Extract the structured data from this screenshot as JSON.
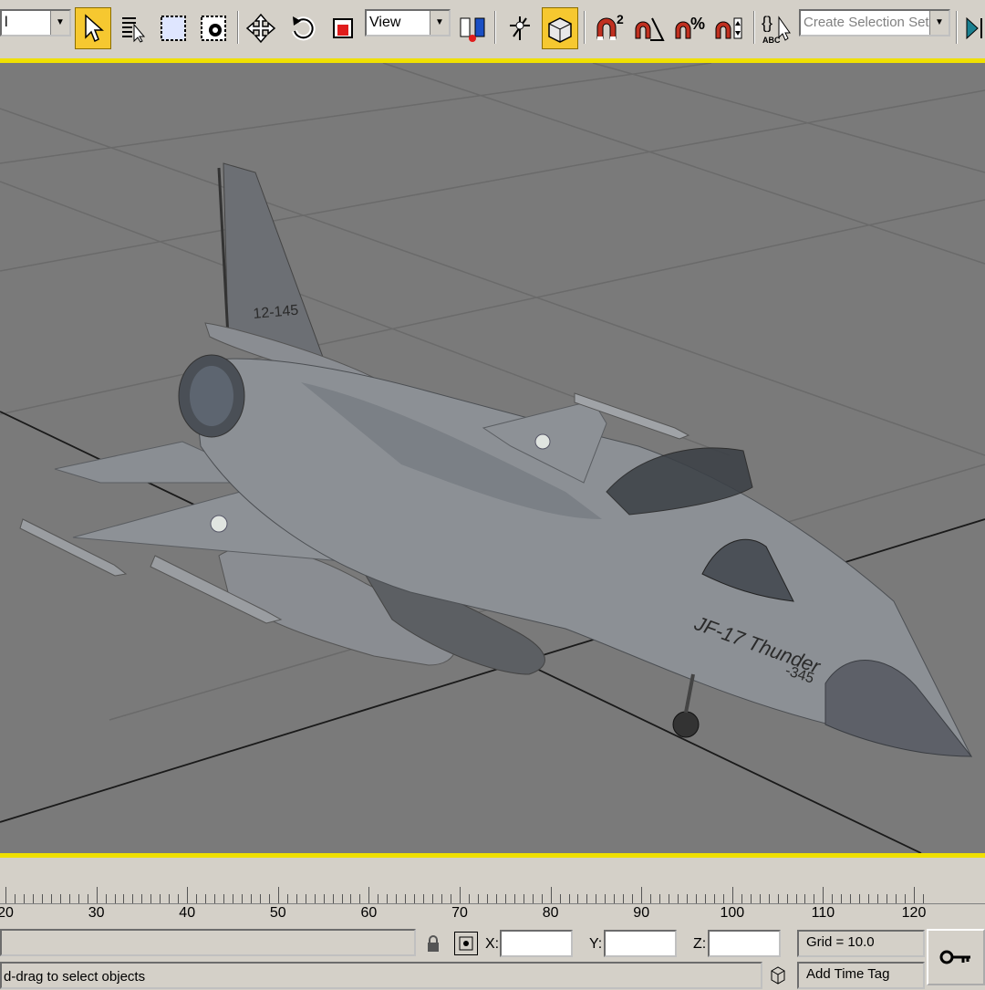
{
  "toolbar": {
    "filter_combo": {
      "value": "l"
    },
    "view_combo": {
      "value": "View"
    },
    "selection_set_combo": {
      "placeholder": "Create Selection Set"
    },
    "snap_labels": {
      "snap2": "2",
      "percent": "%"
    },
    "edit_named_label": "ABC"
  },
  "viewport": {
    "model_markings": {
      "tail_code": "12-145",
      "fuselage_code": "JF-17 Thunder",
      "nose_code": "-345"
    }
  },
  "timeline": {
    "ticks": [
      "20",
      "30",
      "40",
      "50",
      "60",
      "70",
      "80",
      "90",
      "100",
      "110",
      "120"
    ]
  },
  "status": {
    "prompt": "d-drag to select objects",
    "x_label": "X:",
    "y_label": "Y:",
    "z_label": "Z:",
    "x_value": "",
    "y_value": "",
    "z_value": "",
    "grid": "Grid = 10.0",
    "add_time_tag": "Add Time Tag"
  },
  "colors": {
    "accent_yellow": "#f0e000",
    "active_button": "#f6c830",
    "viewport_bg": "#7a7a7a",
    "chrome": "#d4d0c8"
  }
}
